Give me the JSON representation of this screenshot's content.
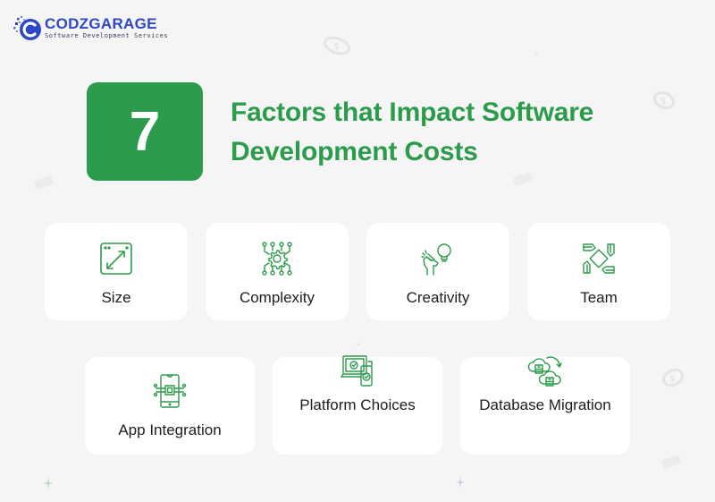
{
  "brand": {
    "name": "CODZGARAGE",
    "tagline": "Software Development Services",
    "color": "#2f47c6"
  },
  "header": {
    "number": "7",
    "title_line1": "Factors that Impact Software",
    "title_line2": "Development Costs",
    "accent_color": "#2c9b4b"
  },
  "factors": [
    {
      "label": "Size",
      "icon": "resize-window-icon"
    },
    {
      "label": "Complexity",
      "icon": "gear-circuit-icon"
    },
    {
      "label": "Creativity",
      "icon": "hand-lightbulb-icon"
    },
    {
      "label": "Team",
      "icon": "team-hands-icon"
    },
    {
      "label": "App Integration",
      "icon": "phone-chip-icon"
    },
    {
      "label": "Platform Choices",
      "icon": "devices-check-icon"
    },
    {
      "label": "Database Migration",
      "icon": "cloud-database-migration-icon"
    }
  ]
}
